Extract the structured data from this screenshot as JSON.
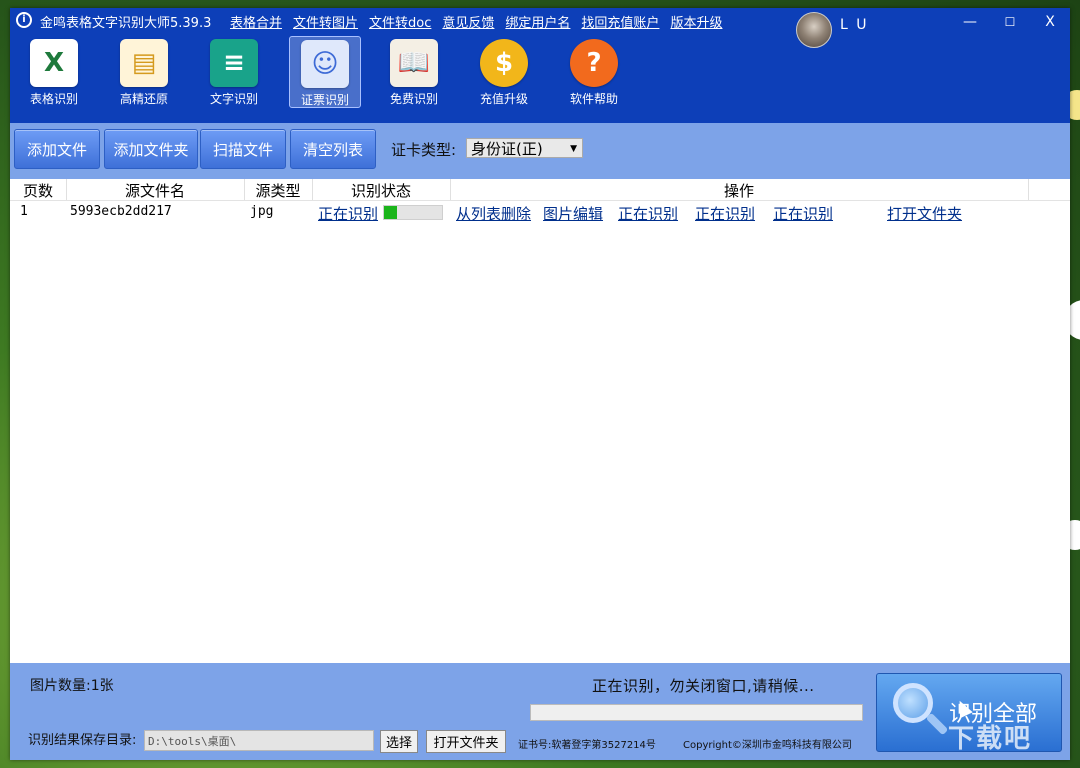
{
  "app": {
    "logo_glyph": "i",
    "title": "金鸣表格文字识别大师5.39.3"
  },
  "top_menu": [
    "表格合并",
    "文件转图片",
    "文件转doc",
    "意见反馈",
    "绑定用户名",
    "找回充值账户",
    "版本升级"
  ],
  "user": {
    "name": "L U"
  },
  "window_controls": {
    "minimize": "—",
    "maximize": "☐",
    "close": "X"
  },
  "toolbar": [
    {
      "label": "表格识别",
      "icon": "excel-icon",
      "glyph": "X",
      "color": "#1e7a3c",
      "bg": "#ffffff"
    },
    {
      "label": "高精还原",
      "icon": "document-layout-icon",
      "glyph": "▤",
      "color": "#d59a1e",
      "bg": "#fff4d8"
    },
    {
      "label": "文字识别",
      "icon": "text-doc-icon",
      "glyph": "≡",
      "color": "#ffffff",
      "bg": "#19a38a"
    },
    {
      "label": "证票识别",
      "icon": "id-card-icon",
      "glyph": "☺",
      "color": "#3d6ad6",
      "bg": "#dfe8fb"
    },
    {
      "label": "免费识别",
      "icon": "book-icon",
      "glyph": "📖",
      "color": "#333333",
      "bg": "#f4efe4"
    },
    {
      "label": "充值升级",
      "icon": "coin-icon",
      "glyph": "$",
      "color": "#ffffff",
      "bg": "#f2b61a"
    },
    {
      "label": "软件帮助",
      "icon": "help-icon",
      "glyph": "?",
      "color": "#ffffff",
      "bg": "#f26a1d"
    }
  ],
  "actions": {
    "add_file": "添加文件",
    "add_folder": "添加文件夹",
    "scan_file": "扫描文件",
    "clear_list": "清空列表",
    "card_type_label": "证卡类型:",
    "card_type_value": "身份证(正)"
  },
  "table": {
    "headers": [
      "页数",
      "源文件名",
      "源类型",
      "识别状态",
      "操作"
    ],
    "rows": [
      {
        "page": "1",
        "filename": "5993ecb2dd217",
        "type": "jpg",
        "status": "正在识别",
        "progress": 0.22,
        "ops": [
          "从列表删除",
          "图片编辑",
          "正在识别",
          "正在识别",
          "正在识别",
          "打开文件夹"
        ]
      }
    ]
  },
  "footer": {
    "image_count": "图片数量:1张",
    "status": "正在识别，勿关闭窗口,请稍候...",
    "save_label": "识别结果保存目录:",
    "save_path": "D:\\tools\\桌面\\",
    "choose": "选择",
    "open_folder": "打开文件夹",
    "certificate": "证书号:软著登字第3527214号",
    "copyright": "Copyright©深圳市金鸣科技有限公司",
    "recognize_all": "识别全部"
  },
  "watermark": "下载吧"
}
